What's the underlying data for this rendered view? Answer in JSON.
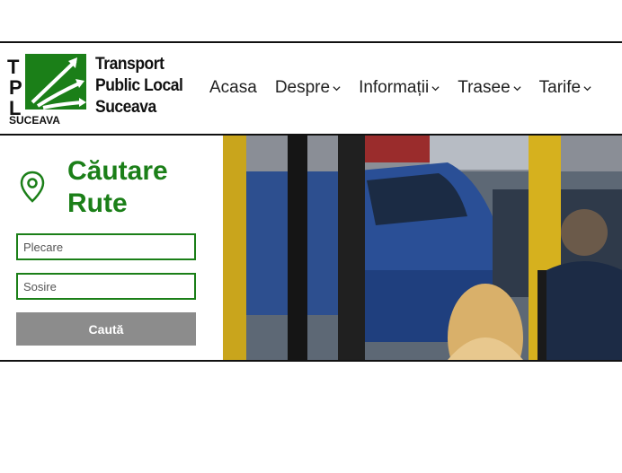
{
  "brand": {
    "logo_letters": [
      "T",
      "P",
      "L"
    ],
    "logo_city": "SUCEAVA",
    "name_lines": [
      "Transport",
      "Public Local",
      "Suceava"
    ]
  },
  "nav": {
    "items": [
      {
        "label": "Acasa",
        "has_dropdown": false
      },
      {
        "label": "Despre",
        "has_dropdown": true
      },
      {
        "label": "Informații",
        "has_dropdown": true
      },
      {
        "label": "Trasee",
        "has_dropdown": true
      },
      {
        "label": "Tarife",
        "has_dropdown": true
      }
    ]
  },
  "search": {
    "title_line1": "Căutare",
    "title_line2": "Rute",
    "from_placeholder": "Plecare",
    "to_placeholder": "Sosire",
    "button_label": "Caută"
  },
  "colors": {
    "accent": "#1b7f18",
    "button": "#8c8c8c"
  }
}
